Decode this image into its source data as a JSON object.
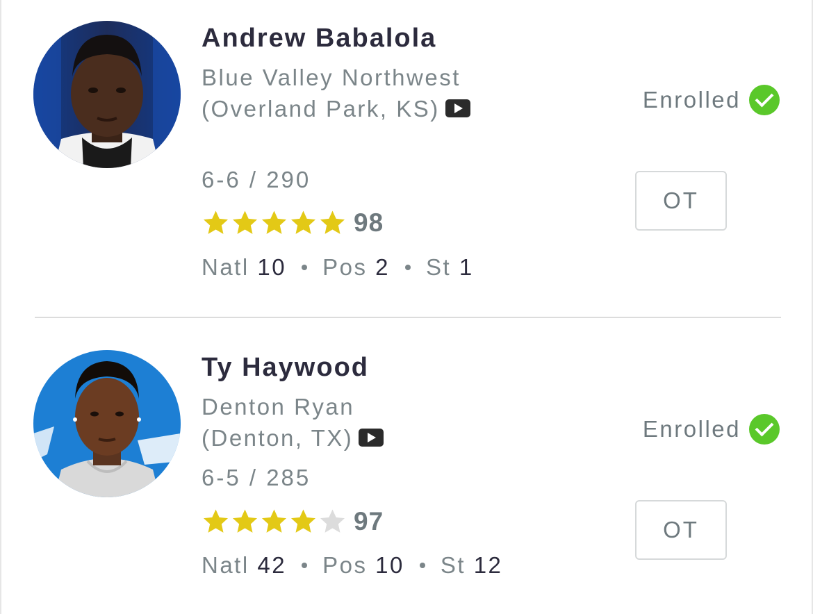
{
  "players": [
    {
      "name": "Andrew Babalola",
      "school": "Blue Valley Northwest (Overland Park, KS)",
      "video_icon": "video-play-icon",
      "measurements": "6-6 / 290",
      "star_rating": 5,
      "score": "98",
      "ranks": {
        "natl_label": "Natl",
        "natl": "10",
        "pos_label": "Pos",
        "pos": "2",
        "st_label": "St",
        "st": "1"
      },
      "status": "Enrolled",
      "position": "OT"
    },
    {
      "name": "Ty Haywood",
      "school": "Denton Ryan (Denton, TX)",
      "video_icon": "video-play-icon",
      "measurements": "6-5 / 285",
      "star_rating": 4,
      "score": "97",
      "ranks": {
        "natl_label": "Natl",
        "natl": "42",
        "pos_label": "Pos",
        "pos": "10",
        "st_label": "St",
        "st": "12"
      },
      "status": "Enrolled",
      "position": "OT"
    }
  ],
  "colors": {
    "star_filled": "#e3c916",
    "star_empty": "#dcdcdc",
    "enrolled_check": "#5ac82a",
    "name_text": "#2c2b3d",
    "muted_text": "#7b8589"
  }
}
